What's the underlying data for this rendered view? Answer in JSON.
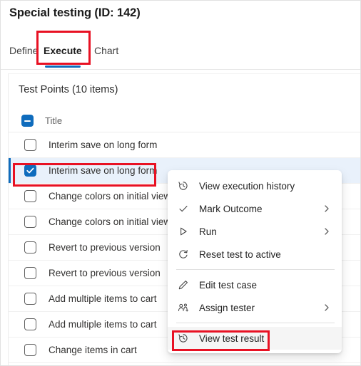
{
  "header": {
    "title": "Special testing (ID: 142)"
  },
  "tabs": [
    {
      "label": "Define",
      "selected": false
    },
    {
      "label": "Execute",
      "selected": true
    },
    {
      "label": "Chart",
      "selected": false
    }
  ],
  "grid": {
    "section_title": "Test Points (10 items)",
    "column_header": "Title",
    "header_checkbox_state": "indeterminate",
    "rows": [
      {
        "title": "Interim save on long form",
        "checked": false,
        "selected": false
      },
      {
        "title": "Interim save on long form",
        "checked": true,
        "selected": true
      },
      {
        "title": "Change colors on initial view",
        "checked": false,
        "selected": false
      },
      {
        "title": "Change colors on initial view",
        "checked": false,
        "selected": false
      },
      {
        "title": "Revert to previous version",
        "checked": false,
        "selected": false
      },
      {
        "title": "Revert to previous version",
        "checked": false,
        "selected": false
      },
      {
        "title": "Add multiple items to cart",
        "checked": false,
        "selected": false
      },
      {
        "title": "Add multiple items to cart",
        "checked": false,
        "selected": false
      },
      {
        "title": "Change items in cart",
        "checked": false,
        "selected": false
      }
    ]
  },
  "context_menu": {
    "items": [
      {
        "label": "View execution history",
        "icon": "history-icon",
        "submenu": false,
        "hover": false
      },
      {
        "label": "Mark Outcome",
        "icon": "checkmark-icon",
        "submenu": true,
        "hover": false
      },
      {
        "label": "Run",
        "icon": "play-icon",
        "submenu": true,
        "hover": false
      },
      {
        "label": "Reset test to active",
        "icon": "refresh-icon",
        "submenu": false,
        "hover": false
      },
      {
        "label": "Edit test case",
        "icon": "pencil-icon",
        "submenu": false,
        "hover": false
      },
      {
        "label": "Assign tester",
        "icon": "assign-user-icon",
        "submenu": true,
        "hover": false
      },
      {
        "label": "View test result",
        "icon": "history-icon",
        "submenu": false,
        "hover": true
      }
    ]
  },
  "annotations": {
    "accent_color": "#e81123",
    "targets": [
      "Execute",
      "Interim save on long form",
      "View test result"
    ]
  },
  "colors": {
    "brand_blue": "#0f6cbd",
    "selected_row_bg": "#e9f1fb",
    "annotation_red": "#e81123"
  }
}
